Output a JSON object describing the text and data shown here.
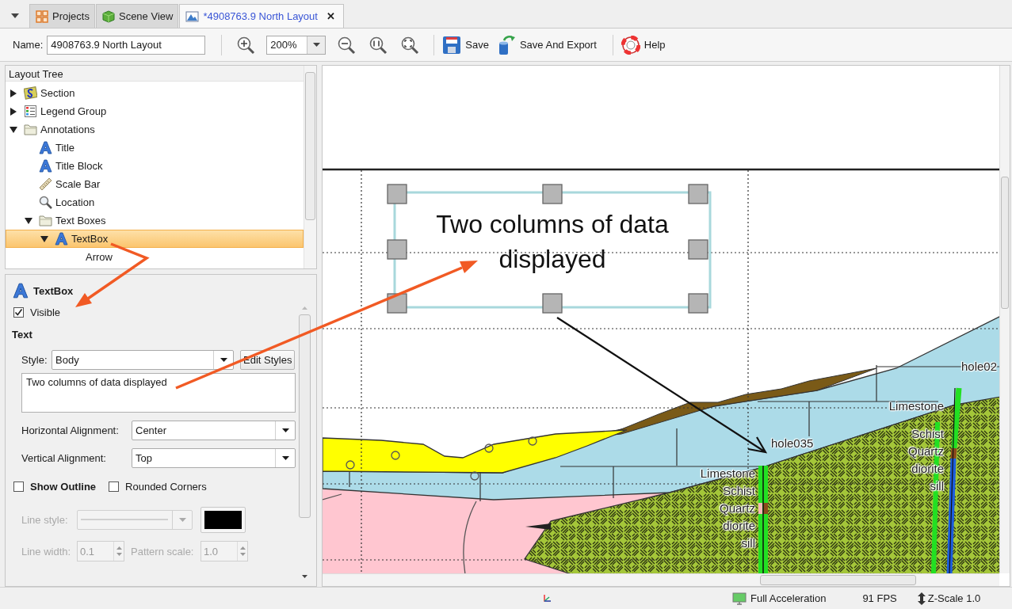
{
  "tabs": [
    {
      "label": "Projects",
      "kind": "projects",
      "selected": false
    },
    {
      "label": "Scene View",
      "kind": "scene",
      "selected": false
    },
    {
      "label": "*4908763.9 North Layout",
      "kind": "layout",
      "selected": true,
      "close": "✕"
    }
  ],
  "toolbar": {
    "name_label": "Name:",
    "name_value": "4908763.9 North Layout",
    "zoom_value": "200%",
    "buttons": [
      {
        "kind": "save",
        "label": "Save"
      },
      {
        "kind": "export",
        "label": "Save And Export"
      },
      {
        "kind": "help",
        "label": "Help"
      }
    ]
  },
  "layout_tree": {
    "title": "Layout Tree",
    "items": [
      {
        "label": "Section",
        "kind": "section",
        "expanded": false,
        "selected": false
      },
      {
        "label": "Legend Group",
        "kind": "legend",
        "expanded": false,
        "selected": false
      },
      {
        "label": "Annotations",
        "kind": "folder",
        "expanded": true,
        "selected": false,
        "children": [
          {
            "label": "Title",
            "kind": "text",
            "selected": false
          },
          {
            "label": "Title Block",
            "kind": "text",
            "selected": false
          },
          {
            "label": "Scale Bar",
            "kind": "ruler",
            "selected": false
          },
          {
            "label": "Location",
            "kind": "magnifier",
            "selected": false
          },
          {
            "label": "Text Boxes",
            "kind": "folder",
            "expanded": true,
            "selected": false,
            "children": [
              {
                "label": "TextBox",
                "kind": "text",
                "expanded": true,
                "selected": true,
                "children": [
                  {
                    "label": "Arrow",
                    "selected": false
                  }
                ]
              }
            ]
          }
        ]
      }
    ]
  },
  "properties": {
    "title": "TextBox",
    "visible": {
      "label": "Visible",
      "checked": true
    },
    "section": "Text",
    "style": {
      "label": "Style:",
      "value": "Body"
    },
    "edit_styles": "Edit Styles",
    "text_value": "Two columns of data displayed",
    "horizontal_alignment": {
      "label": "Horizontal Alignment:",
      "value": "Center"
    },
    "vertical_alignment": {
      "label": "Vertical Alignment:",
      "value": "Top"
    },
    "show_outline": {
      "label": "Show Outline",
      "checked": false
    },
    "rounded_corners": {
      "label": "Rounded Corners",
      "checked": false
    },
    "line_style": {
      "label": "Line style:",
      "disabled": true
    },
    "line_width": {
      "label": "Line width:",
      "value": "0.1",
      "disabled": true
    },
    "pattern_scale": {
      "label": "Pattern scale:",
      "value": "1.0",
      "disabled": true
    }
  },
  "canvas": {
    "text_box": "Two columns of data displayed",
    "wells": [
      {
        "name": "hole035",
        "labels": [
          "Limestone",
          "Schist",
          "Quartz",
          "diorite",
          "sill"
        ]
      },
      {
        "name": "hole02",
        "labels": [
          "Limestone",
          "Schist",
          "Quartz",
          "diorite",
          "sill"
        ]
      }
    ]
  },
  "status_bar": {
    "acceleration": "Full Acceleration",
    "fps": "91 FPS",
    "z_scale": "Z-Scale 1.0"
  }
}
